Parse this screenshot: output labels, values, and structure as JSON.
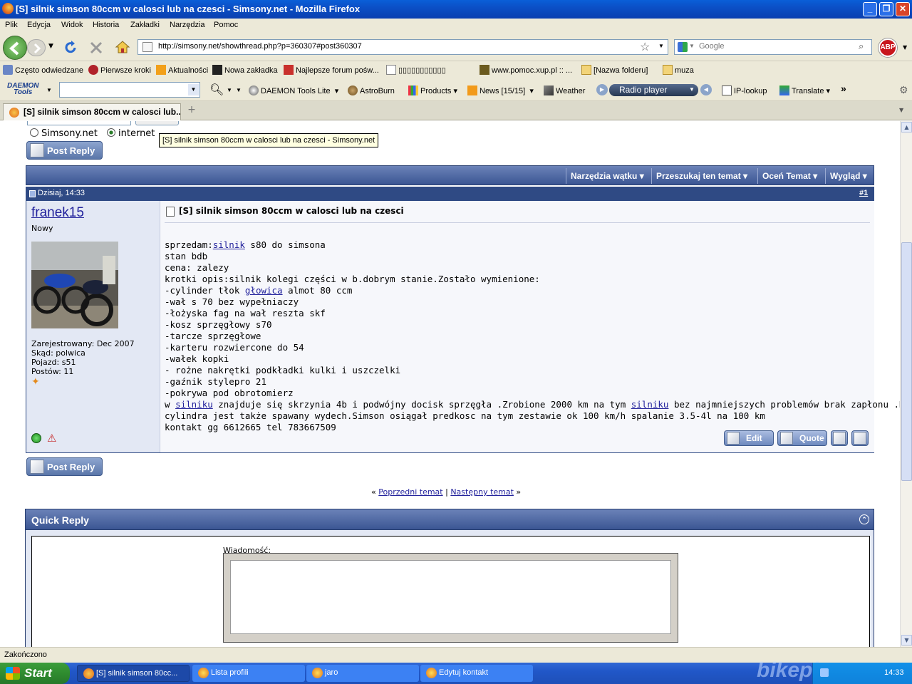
{
  "window": {
    "title": "[S] silnik simson 80ccm w calosci lub na czesci - Simsony.net - Mozilla Firefox"
  },
  "menu": [
    "Plik",
    "Edycja",
    "Widok",
    "Historia",
    "Zakładki",
    "Narzędzia",
    "Pomoc"
  ],
  "nav": {
    "url": "http://simsony.net/showthread.php?p=360307#post360307",
    "search_placeholder": "Google",
    "abp": "ABP"
  },
  "bookmarks": [
    "Często odwiedzane",
    "Pierwsze kroki",
    "Aktualności",
    "Nowa zakładka",
    "Najlepsze forum pośw...",
    "▯▯▯▯▯▯▯▯▯▯▯",
    "www.pomoc.xup.pl :: ...",
    "[Nazwa folderu]",
    "muza"
  ],
  "daemon_toolbar": {
    "logo_top": "DAEMON",
    "logo_bottom": "Tools",
    "items": [
      "DAEMON Tools Lite",
      "AstroBurn",
      "Products",
      "News [15/15]",
      "Weather",
      "Radio player",
      "IP-lookup",
      "Translate"
    ]
  },
  "tab": {
    "label": "[S] silnik simson 80ccm w calosci lub...",
    "new_tab": "+"
  },
  "tooltip": "[S] silnik simson 80ccm w calosci lub na czesci - Simsony.net",
  "search_scope": {
    "opt1": "Simsony.net",
    "opt2": "internet"
  },
  "buttons": {
    "post_reply": "Post Reply",
    "edit": "Edit",
    "quote": "Quote"
  },
  "thread_tools": [
    "Narzędzia wątku",
    "Przeszukaj ten temat",
    "Oceń Temat",
    "Wygląd"
  ],
  "post": {
    "date": "Dzisiaj, 14:33",
    "number": "#1",
    "author": "franek15",
    "rank": "Nowy",
    "stats": [
      "Zarejestrowany: Dec 2007",
      "Skąd: polwica",
      "Pojazd: s51",
      "Postów: 11"
    ],
    "title": "[S] silnik simson 80ccm w calosci lub na czesci",
    "line1_pre": "sprzedam:",
    "line1_link": "silnik",
    "line1_post": " s80 do simsona",
    "lines_a": [
      "stan bdb",
      "cena: zalezy",
      "krotki opis:silnik kolegi części w b.dobrym stanie.Zostało wymienione:"
    ],
    "line5_pre": "-cylinder tłok ",
    "line5_link": "głowica",
    "line5_post": " almot 80 ccm",
    "lines_b": [
      "-wał s 70 bez wypełniaczy",
      "-łożyska fag na wał reszta skf",
      "-kosz sprzęgłowy s70",
      "-tarcze sprzęgłowe",
      "-karteru rozwiercone do 54",
      "-wałek kopki",
      "- rożne nakrętki podkładki kulki i uszczelki",
      "-gaźnik stylepro 21",
      "-pokrywa pod obrotomierz"
    ],
    "line15_pre": "w ",
    "line15_link1": "silniku",
    "line15_mid": " znajduje się skrzynia 4b i podwójny docisk sprzęgła .Zrobione 2000 km na tym ",
    "line15_link2": "silniku",
    "line15_post": " bez najmniejszych problemów brak zapłonu .Do",
    "lines_c": [
      "cylindra jest także spawany wydech.Simson osiągał predkosc na tym zestawie ok 100 km/h spalanie 3.5-4l na 100 km",
      "kontakt gg 6612665 tel 783667509"
    ]
  },
  "thread_nav": {
    "prev": "Poprzedni temat",
    "sep": "|",
    "next": "Następny temat",
    "left_q": "«",
    "right_q": "»"
  },
  "quick_reply": {
    "title": "Quick Reply",
    "label": "Wiadomość:"
  },
  "status": "Zakończono",
  "taskbar": {
    "start": "Start",
    "tasks": [
      "[S] silnik simson 80cc...",
      "Lista profili",
      "jaro",
      "Edytuj kontakt"
    ],
    "clock": "14:33",
    "watermark": "bikepics"
  }
}
